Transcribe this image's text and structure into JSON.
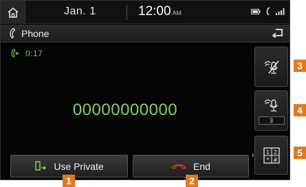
{
  "status_bar": {
    "date": "Jan.  1",
    "time": "12:00",
    "ampm": "AM"
  },
  "title_bar": {
    "title": "Phone"
  },
  "call": {
    "timer": "0:17",
    "number": "00000000000"
  },
  "side_panel": {
    "volume_value": "3"
  },
  "buttons": {
    "use_private": "Use Private",
    "end": "End"
  },
  "callouts": [
    "1",
    "2",
    "3",
    "4",
    "5"
  ],
  "colors": {
    "accent_green": "#8bd05a",
    "end_red": "#d23a2a",
    "callout_orange": "#e07a1f"
  }
}
